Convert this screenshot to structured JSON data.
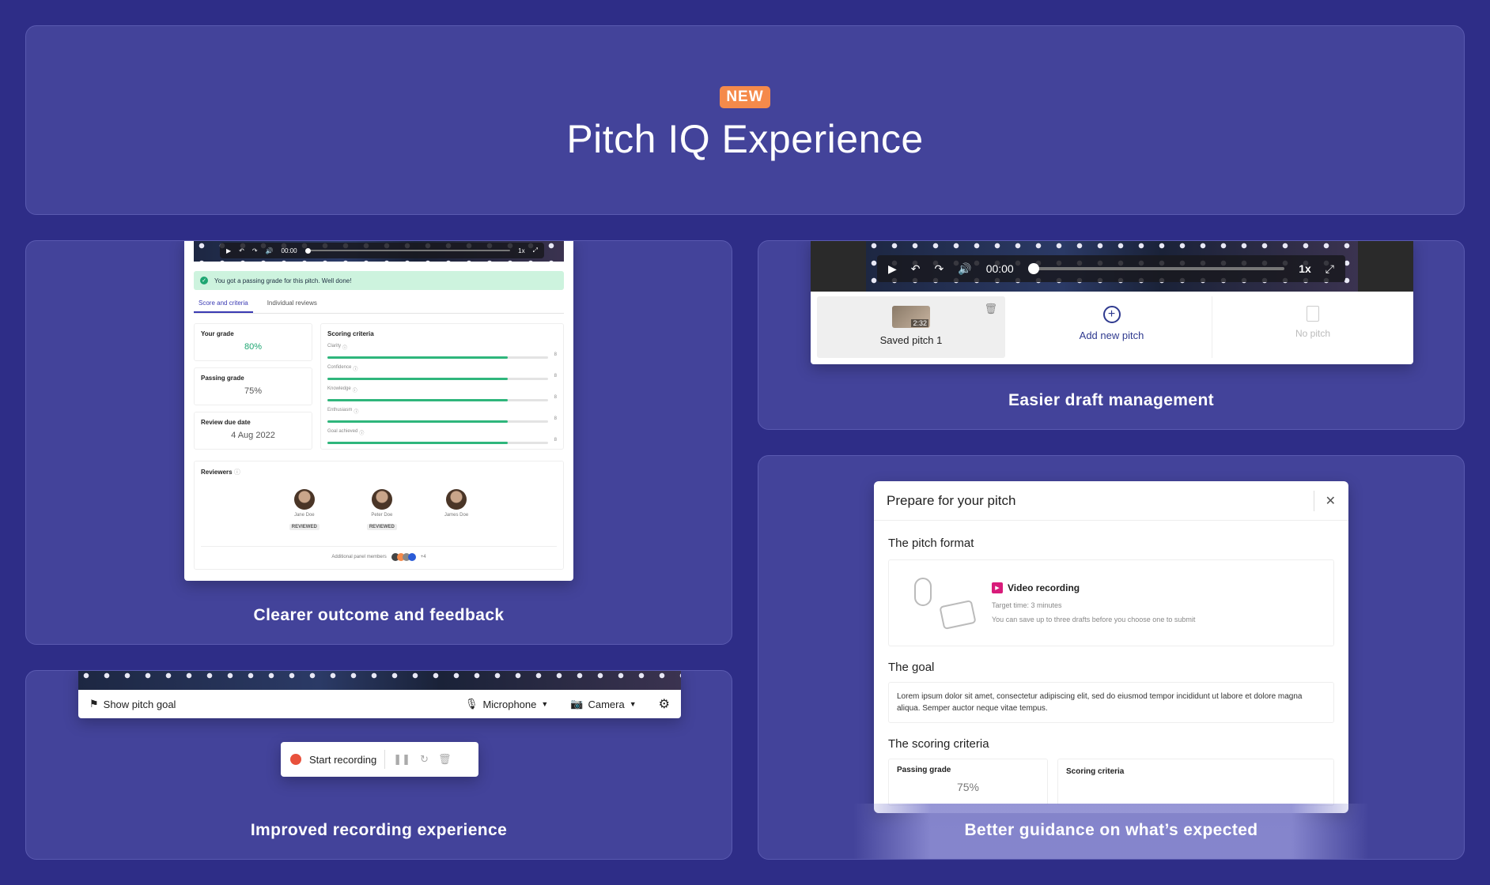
{
  "hero": {
    "badge": "NEW",
    "title": "Pitch IQ Experience"
  },
  "feedback_panel": {
    "caption": "Clearer outcome and feedback",
    "player": {
      "time": "00:00",
      "speed": "1x"
    },
    "alert": "You got a passing grade for this pitch. Well done!",
    "tabs": [
      "Score and criteria",
      "Individual reviews"
    ],
    "your_grade": {
      "label": "Your grade",
      "value": "80%"
    },
    "passing_grade": {
      "label": "Passing grade",
      "value": "75%"
    },
    "review_due": {
      "label": "Review due date",
      "value": "4 Aug 2022"
    },
    "scoring": {
      "title": "Scoring criteria",
      "items": [
        {
          "name": "Clarity",
          "score": "8",
          "fill": 0.82
        },
        {
          "name": "Confidence",
          "score": "8",
          "fill": 0.82
        },
        {
          "name": "Knowledge",
          "score": "8",
          "fill": 0.82
        },
        {
          "name": "Enthusiasm",
          "score": "8",
          "fill": 0.82
        },
        {
          "name": "Goal achieved",
          "score": "8",
          "fill": 0.82
        }
      ]
    },
    "reviewers": {
      "title": "Reviewers",
      "people": [
        {
          "name": "Jane Doe",
          "status": "REVIEWED"
        },
        {
          "name": "Peter Doe",
          "status": "REVIEWED"
        },
        {
          "name": "James Doe",
          "status": ""
        }
      ],
      "additional_label": "Additional panel members",
      "additional_count": "+4"
    }
  },
  "draft_panel": {
    "caption": "Easier draft management",
    "player": {
      "time": "00:00",
      "speed": "1x"
    },
    "slots": [
      {
        "label": "Saved pitch 1",
        "duration": "2:32"
      },
      {
        "label": "Add new pitch"
      },
      {
        "label": "No pitch"
      }
    ]
  },
  "recording_panel": {
    "caption": "Improved recording experience",
    "show_goal": "Show pitch goal",
    "microphone": "Microphone",
    "camera": "Camera",
    "start_recording": "Start recording"
  },
  "guidance_panel": {
    "caption": "Better guidance on what’s expected",
    "modal_title": "Prepare for your pitch",
    "format_heading": "The pitch format",
    "format_type": "Video recording",
    "target_time": "Target time: 3 minutes",
    "drafts_note": "You can save up to three drafts before you choose one to submit",
    "goal_heading": "The goal",
    "goal_text": "Lorem ipsum dolor sit amet, consectetur adipiscing elit, sed do eiusmod tempor incididunt ut labore et dolore magna aliqua. Semper auctor neque vitae tempus.",
    "scoring_heading": "The scoring criteria",
    "passing_label": "Passing grade",
    "passing_value": "75%",
    "criteria_label": "Scoring criteria"
  },
  "colors": {
    "background": "#2e2d87",
    "panel": "#43439a",
    "badge": "#f58a4b",
    "accent_green": "#1ea672",
    "accent_red": "#e8513c",
    "accent_magenta": "#d81b7a"
  }
}
